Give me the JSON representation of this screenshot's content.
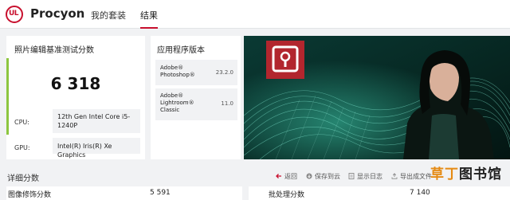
{
  "header": {
    "app_name": "Procyon",
    "nav": [
      {
        "label": "我的套装"
      },
      {
        "label": "结果"
      }
    ]
  },
  "score_card": {
    "title": "照片编辑基准测试分数",
    "score": "6 318",
    "cpu_label": "CPU:",
    "cpu_value": "12th Gen Intel Core i5-1240P",
    "gpu_label": "GPU:",
    "gpu_value": "Intel(R) Iris(R) Xe Graphics"
  },
  "versions": {
    "title": "应用程序版本",
    "items": [
      {
        "name": "Adobe® Photoshop®",
        "version": "23.2.0"
      },
      {
        "name": "Adobe® Lightroom® Classic",
        "version": "11.0"
      }
    ]
  },
  "details": {
    "title": "详细分数",
    "actions": [
      {
        "label": "返回",
        "icon": "back-arrow-icon"
      },
      {
        "label": "保存到云",
        "icon": "cloud-save-icon"
      },
      {
        "label": "显示日志",
        "icon": "log-icon"
      },
      {
        "label": "导出成文件",
        "icon": "export-icon"
      }
    ],
    "rows": [
      {
        "label": "图像修饰分数",
        "value": "5 591"
      },
      {
        "label": "批处理分数",
        "value": "7 140"
      }
    ]
  },
  "watermark": {
    "part1": "草丁",
    "part2": "图书馆"
  },
  "colors": {
    "brand": "#c8102e",
    "accent_bar": "#8dc63f",
    "hero_bg": "#06231f",
    "logo_tile": "#b2262e"
  }
}
